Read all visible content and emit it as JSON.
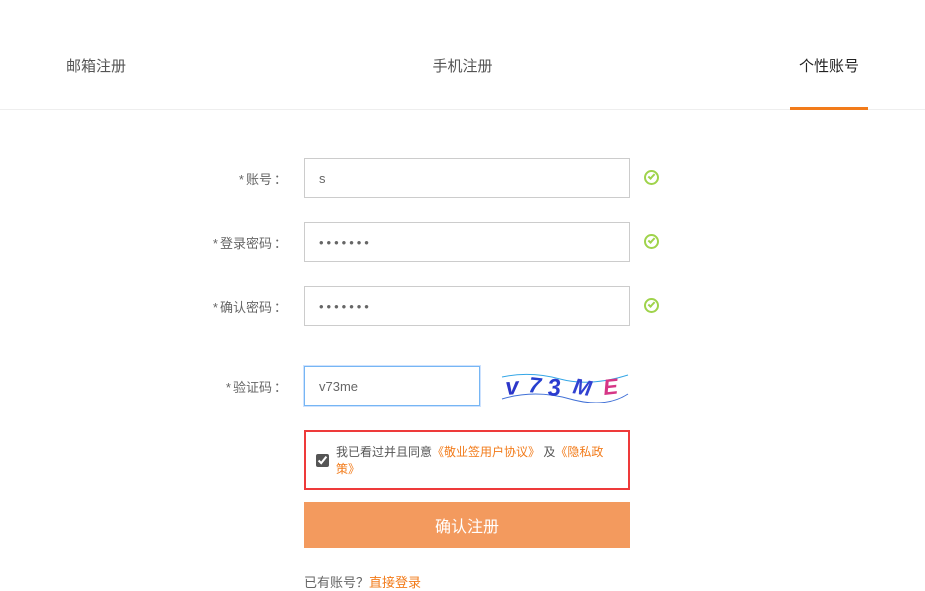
{
  "tabs": {
    "email": "邮箱注册",
    "phone": "手机注册",
    "personal": "个性账号"
  },
  "labels": {
    "account": "账号",
    "password": "登录密码",
    "confirm": "确认密码",
    "captcha": "验证码",
    "asterisk": "*",
    "colon": "："
  },
  "fields": {
    "account_value": "s",
    "password_value": "•••••••",
    "confirm_value": "•••••••",
    "captcha_value": "v73me",
    "captcha_image_text": "v73ME"
  },
  "agreement": {
    "text_prefix": "我已看过并且同意",
    "link1": "《敬业签用户协议》",
    "connector": " 及",
    "link2": "《隐私政策》"
  },
  "submit": "确认注册",
  "already": {
    "text": "已有账号？",
    "link": "直接登录"
  }
}
